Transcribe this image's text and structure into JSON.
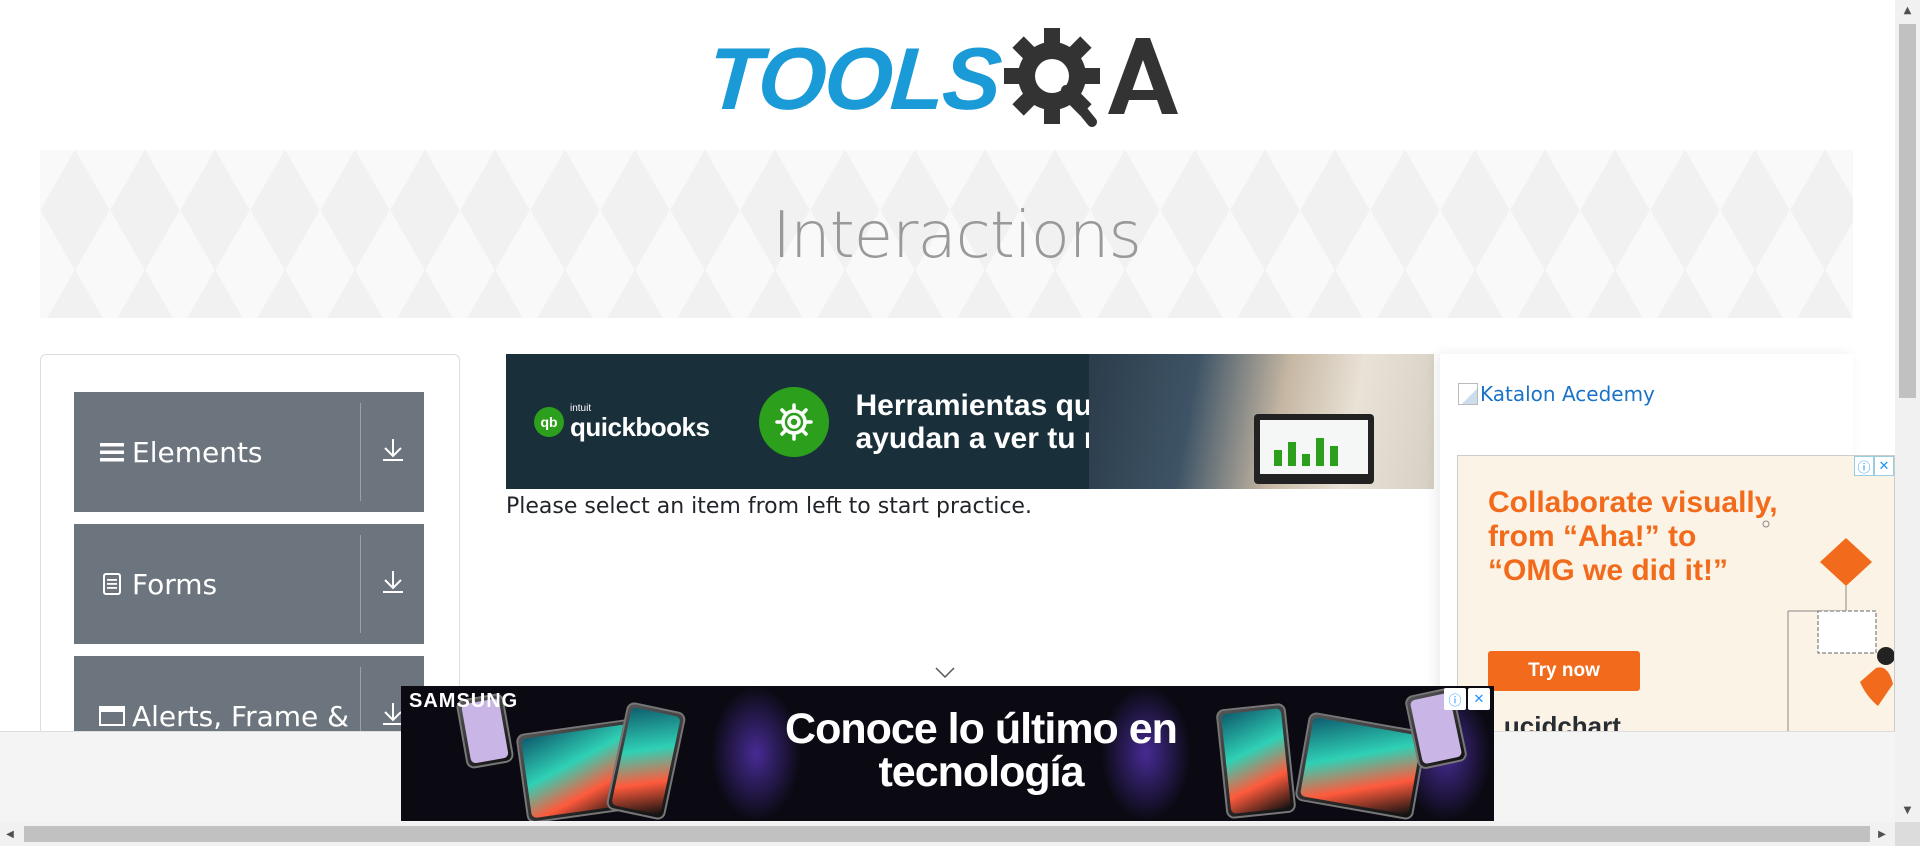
{
  "logo": {
    "text": "TOOLS",
    "mark": "QA"
  },
  "banner": {
    "title": "Interactions"
  },
  "sidebar": {
    "groups": [
      {
        "label": "Elements",
        "icon": "hamburger-icon"
      },
      {
        "label": "Forms",
        "icon": "document-icon"
      },
      {
        "label": "Alerts, Frame &",
        "icon": "window-icon"
      }
    ]
  },
  "ads": {
    "quickbooks": {
      "brand_small": "intuit",
      "brand": "quickbooks",
      "brand_badge": "qb",
      "headline": "Herramientas que te ayudan a ver tu negocio"
    },
    "katalon": {
      "alt_text": "Katalon Acedemy"
    },
    "lucidchart": {
      "headline": "Collaborate visually, from “Aha!” to “OMG we did it!”",
      "button": "Try now",
      "brand": "Lucidchart"
    },
    "samsung": {
      "brand": "SAMSUNG",
      "headline": "Conoce lo último en tecnología"
    },
    "badges": {
      "info": "ⓘ",
      "close": "✕"
    }
  },
  "main": {
    "intro": "Please select an item from left to start practice."
  },
  "colors": {
    "logo_blue": "#1a9ad6",
    "sidebar_gray": "#6c757d",
    "lucid_orange": "#f26a1b",
    "qb_green": "#2ca01c"
  }
}
